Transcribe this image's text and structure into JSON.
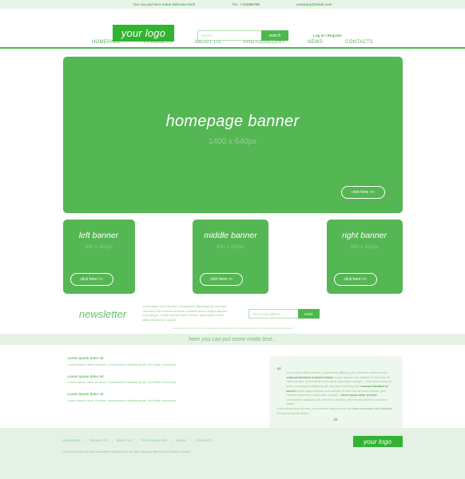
{
  "colors": {
    "brand_green": "#32b332",
    "banner_green": "#55b654",
    "accent_green": "#4db84d",
    "pale_green": "#e4f1e4",
    "muted_text": "#8cc98c"
  },
  "topbar": {
    "welcome": "You can put here some welcome text!",
    "phone": "Tel.: +123456789",
    "email": "company@email.com"
  },
  "header": {
    "logo": "your logo",
    "search": {
      "placeholder": "Search",
      "value": "",
      "button": "search"
    },
    "account": "Log in / Register"
  },
  "nav": {
    "items": [
      {
        "label": "HOMEPAGE"
      },
      {
        "label": "PRODUCTS"
      },
      {
        "label": "ABOUT US"
      },
      {
        "label": "PHOTOGALLERY"
      },
      {
        "label": "NEWS"
      },
      {
        "label": "CONTACTS"
      }
    ]
  },
  "hero": {
    "title": "homepage banner",
    "size": "1400 x 640px",
    "cta": "click here >>"
  },
  "banners": [
    {
      "title": "left banner",
      "size": "300 x 300px",
      "cta": "click here >>"
    },
    {
      "title": "middle banner",
      "size": "300 x 300px",
      "cta": "click here >>"
    },
    {
      "title": "right banner",
      "size": "300 x 300px",
      "cta": "click here >>"
    }
  ],
  "newsletter": {
    "title": "newsletter",
    "lorem": "Lorem ipsum dolor sit amet, consectetuer adipiscing elit, sed diam nonummy nibh euismod tincidunt ut laoreet dolore magna aliquam erat volutpat. Ut wisi enim ad minim veniam, quis nostrud exerci tation ullamcorper suscipit...",
    "email_placeholder": "Your email address",
    "email_value": "",
    "send_label": "send",
    "footnote": "Lorem ipsum dolor sit amet, consectetuer adipiscing elit, sed diam nonummy nibh euismod tincidunt ut laoreet"
  },
  "motto": {
    "text": "here you can put some motto text..."
  },
  "news_items": [
    {
      "title": "Lorem ipsum dolor sit",
      "body": "Lorem ipsum dolor sit amet, consectetuer adipiscing elit, sed diam nonummy"
    },
    {
      "title": "Lorem ipsum dolor sit",
      "body": "Lorem ipsum dolor sit amet, consectetuer adipiscing elit, sed diam nonummy"
    },
    {
      "title": "Lorem ipsum dolor sit",
      "body": "Lorem ipsum dolor sit amet, consectetuer adipiscing elit, sed diam nonummy"
    }
  ],
  "quote": {
    "open_mark": "“",
    "close_mark": "”",
    "body_html": "Lorem ipsum dolor sit amet, consectetuer adipiscing elit, sed diam nonummy nibh <b>euismod tincidunt ut laoreet dolore</b> magna aliquam erat volutpat. Ut wisi enim ad minim veniam, quis nostrud exerci tation ullamcorper suscipit... Lorem ipsum dolor sit amet, consectetuer adipiscing elit, sed diam nonummy nibh <b>euismod tincidunt ut laoreet</b> dolore magna aliquam erat volutpat. Ut wisi enim ad minim veniam, quis nostrud exerci tation ullamcorper suscipit... <b>Lorem ipsum dolor sit amet</b>, consectetuer adipiscing elit, sed diam nonummy nibh euismod tincidunt ut laoreet dolore...",
    "tail_html": "Lorem ipsum dolor sit amet, consectetuer adipiscing elit, sed <b>diam nonummy nibh euismod</b> tincidunt ut laoreet dolore..."
  },
  "footer": {
    "nav": [
      {
        "label": "HOMEPAGE"
      },
      {
        "label": "PRODUCTS"
      },
      {
        "label": "ABOUT US"
      },
      {
        "label": "PHOTOGALLERY"
      },
      {
        "label": "NEWS"
      },
      {
        "label": "CONTACTS"
      }
    ],
    "separator": "|",
    "copyright": "Lorem ipsum dolor sit amet, consectetuer adipiscing elit, sed diam nonummy nibh euismod tincidunt ut laoreet",
    "logo": "your logo"
  }
}
